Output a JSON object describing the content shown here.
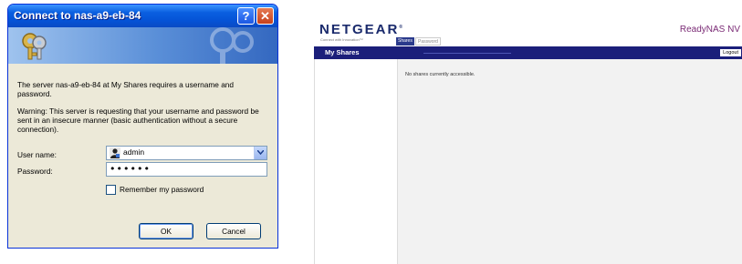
{
  "dialog": {
    "title": "Connect to nas-a9-eb-84",
    "help_label": "?",
    "close_label": "✕",
    "description": "The server nas-a9-eb-84 at My Shares requires a username and password.",
    "warning": "Warning: This server is requesting that your username and password be sent in an insecure manner (basic authentication without a secure connection).",
    "username_label": "User name:",
    "username_value": "admin",
    "password_label": "Password:",
    "password_value": "••••••",
    "remember_label": "Remember my password",
    "remember_checked": false,
    "ok_label": "OK",
    "cancel_label": "Cancel",
    "icons": [
      "keys-icon",
      "user-icon",
      "chevron-down-icon"
    ]
  },
  "web": {
    "logo": "NETGEAR",
    "logo_mark": "®",
    "tagline": "Connect with Innovation™",
    "product": "ReadyNAS NV",
    "tabs": [
      {
        "label": "Shares",
        "active": true
      },
      {
        "label": "Password",
        "active": false
      }
    ],
    "nav_title": "My Shares",
    "logout_label": "Logout",
    "message": "No shares currently accessible.",
    "colors": {
      "nav": "#1b1f7a",
      "product": "#7a2a75",
      "content_bg": "#f2f2f2"
    }
  }
}
